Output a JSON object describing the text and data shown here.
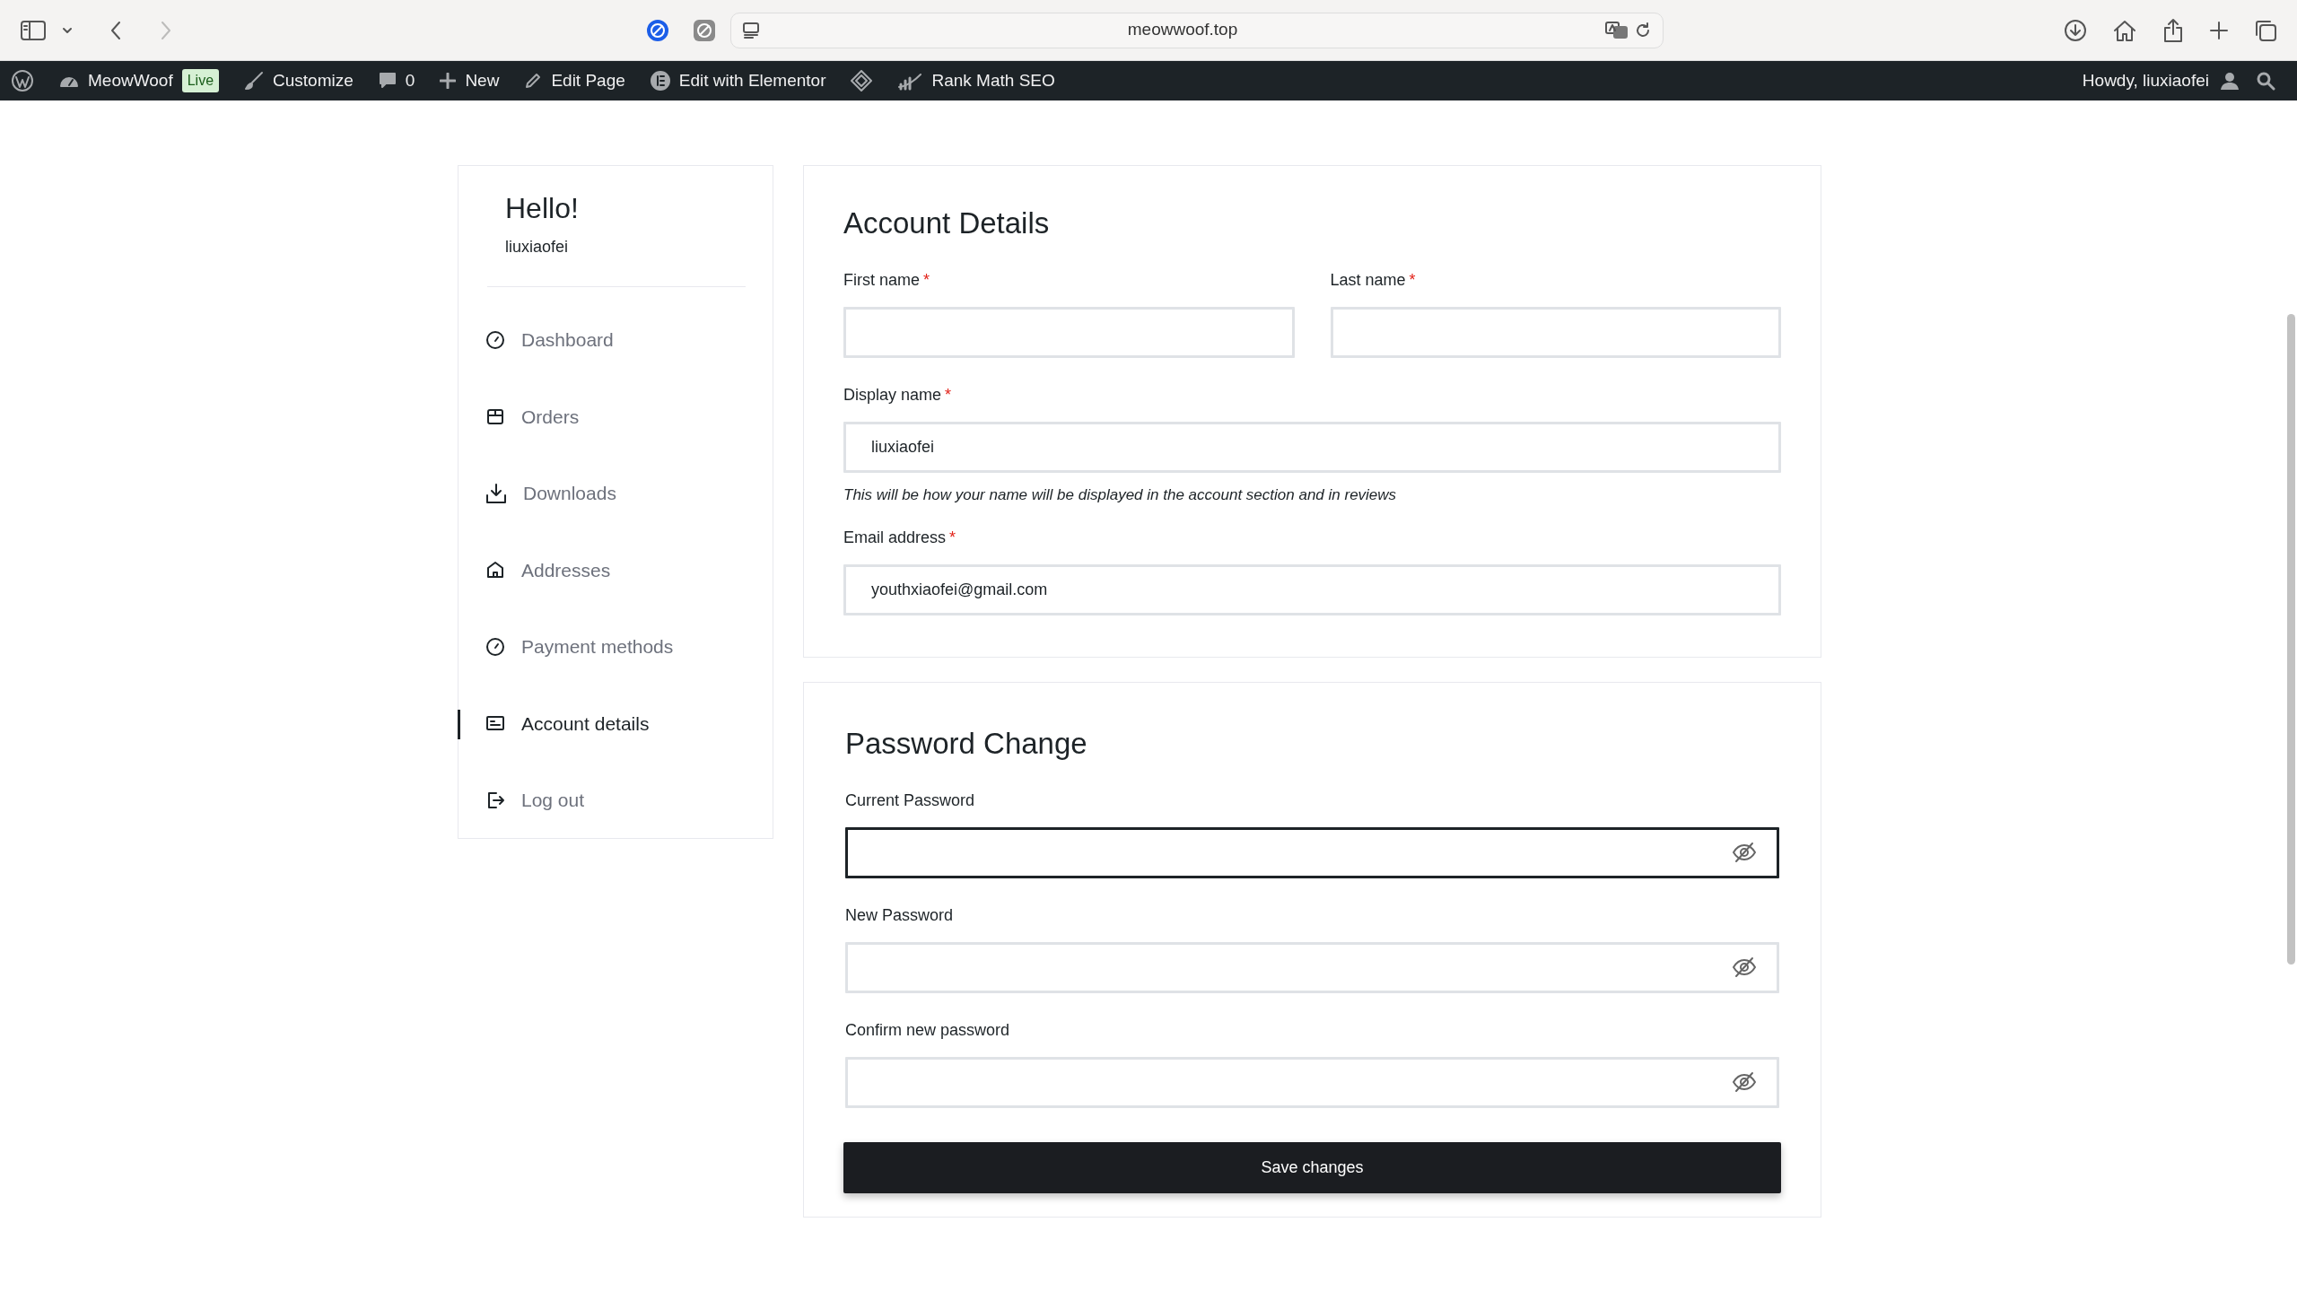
{
  "browser": {
    "back": {
      "disabled": false
    },
    "forward": {
      "disabled": true
    },
    "url": "meowwoof.top"
  },
  "admin_bar": {
    "items": [
      {
        "kind": "wordpress"
      },
      {
        "kind": "site",
        "label": "MeowWoof",
        "badge": "Live"
      },
      {
        "kind": "customize",
        "label": "Customize"
      },
      {
        "kind": "comments",
        "label": "0"
      },
      {
        "kind": "new",
        "label": "New"
      },
      {
        "kind": "edit",
        "label": "Edit Page"
      },
      {
        "kind": "elementor",
        "label": "Edit with Elementor"
      },
      {
        "kind": "diamond"
      },
      {
        "kind": "rankmath",
        "label": "Rank Math SEO"
      }
    ],
    "greeting": "Howdy, liuxiaofei"
  },
  "sidebar": {
    "title": "Hello!",
    "username": "liuxiaofei",
    "items": [
      {
        "label": "Dashboard",
        "selected": false
      },
      {
        "label": "Orders",
        "selected": false
      },
      {
        "label": "Downloads",
        "selected": false
      },
      {
        "label": "Addresses",
        "selected": false
      },
      {
        "label": "Payment methods",
        "selected": false
      },
      {
        "label": "Account details",
        "selected": true
      },
      {
        "label": "Log out",
        "selected": false
      }
    ]
  },
  "account_details": {
    "title": "Account Details",
    "name_fields": [
      {
        "label": "First name",
        "required_mark": "*"
      },
      {
        "label": "Last name",
        "required_mark": "*"
      }
    ],
    "display_name": {
      "label": "Display name",
      "required_mark": "*",
      "value": "liuxiaofei",
      "hint": "This will be how your name will be displayed in the account section and in reviews"
    },
    "email": {
      "label": "Email address",
      "required_mark": "*",
      "value": "youthxiaofei@gmail.com"
    }
  },
  "password_change": {
    "title": "Password Change",
    "fields": [
      {
        "label": "Current Password",
        "focused": true
      },
      {
        "label": "New Password",
        "focused": false
      },
      {
        "label": "Confirm new password",
        "focused": false
      }
    ],
    "button": "Save changes"
  }
}
